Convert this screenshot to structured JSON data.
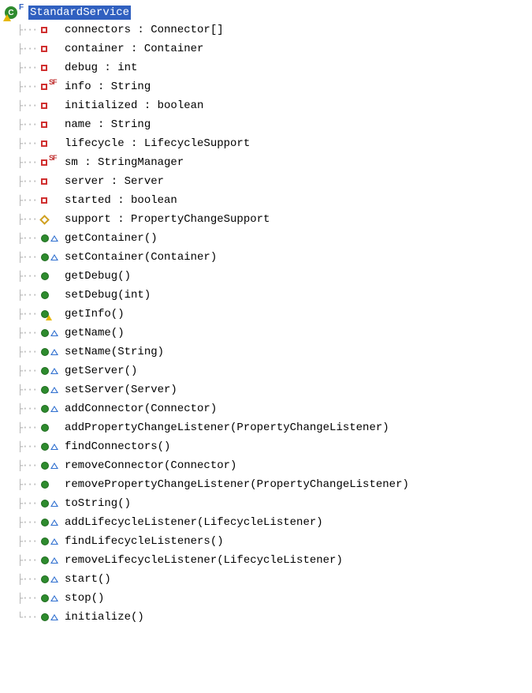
{
  "root": {
    "name": "StandardService",
    "letter": "C",
    "final_marker": "F"
  },
  "members": [
    {
      "kind": "field-private",
      "sf": false,
      "label": "connectors : Connector[]"
    },
    {
      "kind": "field-private",
      "sf": false,
      "label": "container : Container"
    },
    {
      "kind": "field-private",
      "sf": false,
      "label": "debug : int"
    },
    {
      "kind": "field-private",
      "sf": true,
      "label": "info : String"
    },
    {
      "kind": "field-private",
      "sf": false,
      "label": "initialized : boolean"
    },
    {
      "kind": "field-private",
      "sf": false,
      "label": "name : String"
    },
    {
      "kind": "field-private",
      "sf": false,
      "label": "lifecycle : LifecycleSupport"
    },
    {
      "kind": "field-private",
      "sf": true,
      "label": "sm : StringManager"
    },
    {
      "kind": "field-private",
      "sf": false,
      "label": "server : Server"
    },
    {
      "kind": "field-private",
      "sf": false,
      "label": "started : boolean"
    },
    {
      "kind": "field-default",
      "sf": false,
      "label": "support : PropertyChangeSupport"
    },
    {
      "kind": "method-override",
      "label": "getContainer()"
    },
    {
      "kind": "method-override",
      "label": "setContainer(Container)"
    },
    {
      "kind": "method",
      "label": "getDebug()"
    },
    {
      "kind": "method",
      "label": "setDebug(int)"
    },
    {
      "kind": "method-warn",
      "label": "getInfo()"
    },
    {
      "kind": "method-override",
      "label": "getName()"
    },
    {
      "kind": "method-override",
      "label": "setName(String)"
    },
    {
      "kind": "method-override",
      "label": "getServer()"
    },
    {
      "kind": "method-override",
      "label": "setServer(Server)"
    },
    {
      "kind": "method-override",
      "label": "addConnector(Connector)"
    },
    {
      "kind": "method",
      "label": "addPropertyChangeListener(PropertyChangeListener)"
    },
    {
      "kind": "method-override",
      "label": "findConnectors()"
    },
    {
      "kind": "method-override",
      "label": "removeConnector(Connector)"
    },
    {
      "kind": "method",
      "label": "removePropertyChangeListener(PropertyChangeListener)"
    },
    {
      "kind": "method-override",
      "label": "toString()"
    },
    {
      "kind": "method-override",
      "label": "addLifecycleListener(LifecycleListener)"
    },
    {
      "kind": "method-override",
      "label": "findLifecycleListeners()"
    },
    {
      "kind": "method-override",
      "label": "removeLifecycleListener(LifecycleListener)"
    },
    {
      "kind": "method-override",
      "label": "start()"
    },
    {
      "kind": "method-override",
      "label": "stop()"
    },
    {
      "kind": "method-override",
      "label": "initialize()"
    }
  ],
  "sf_text": "SF"
}
